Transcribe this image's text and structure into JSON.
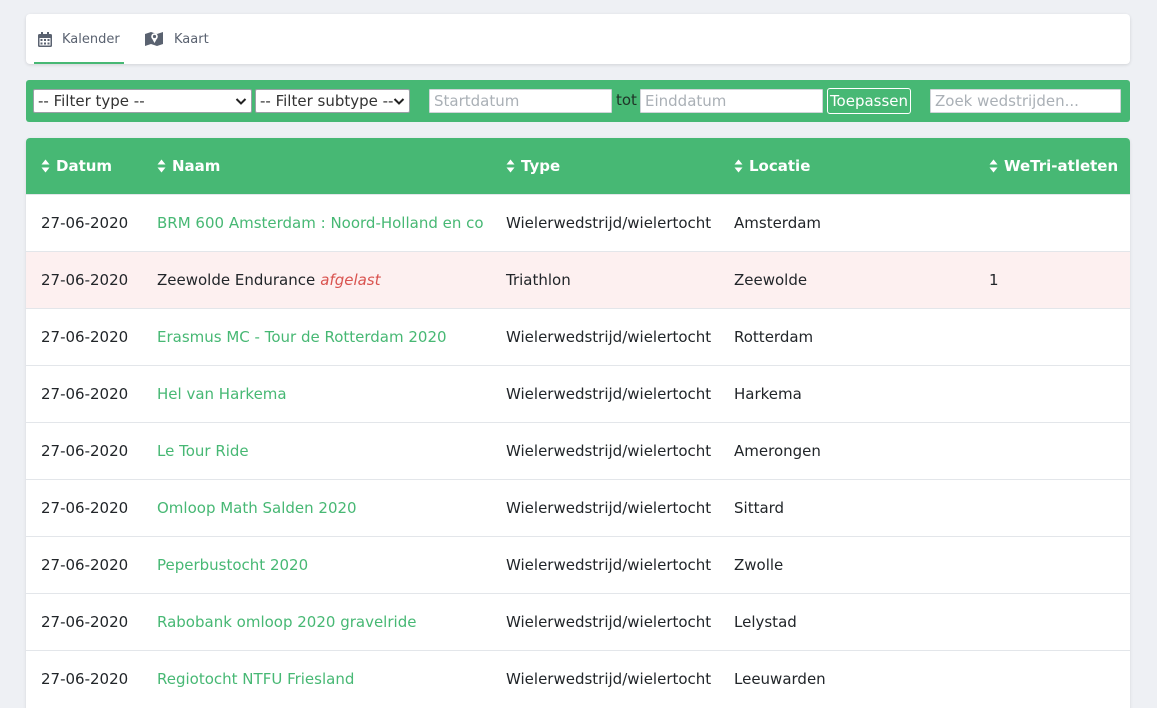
{
  "tabs": [
    {
      "label": "Kalender",
      "icon": "calendar-icon",
      "active": true
    },
    {
      "label": "Kaart",
      "icon": "map-icon",
      "active": false
    }
  ],
  "filters": {
    "type_selected": "-- Filter type --",
    "subtype_selected": "-- Filter subtype --",
    "start_placeholder": "Startdatum",
    "between_label": "tot",
    "end_placeholder": "Einddatum",
    "apply_label": "Toepassen",
    "search_placeholder": "Zoek wedstrijden..."
  },
  "colors": {
    "accent": "#47b874",
    "cancelled_row": "#fdf0f0",
    "cancelled_text": "#d9534f"
  },
  "table": {
    "columns": [
      "Datum",
      "Naam",
      "Type",
      "Locatie",
      "WeTri-atleten"
    ],
    "rows": [
      {
        "date": "27-06-2020",
        "name": "BRM 600 Amsterdam : Noord-Holland en co",
        "link": true,
        "status": "",
        "type": "Wielerwedstrijd/wielertocht",
        "location": "Amsterdam",
        "athletes": ""
      },
      {
        "date": "27-06-2020",
        "name": "Zeewolde Endurance",
        "link": false,
        "status": "afgelast",
        "type": "Triathlon",
        "location": "Zeewolde",
        "athletes": "1"
      },
      {
        "date": "27-06-2020",
        "name": "Erasmus MC - Tour de Rotterdam 2020",
        "link": true,
        "status": "",
        "type": "Wielerwedstrijd/wielertocht",
        "location": "Rotterdam",
        "athletes": ""
      },
      {
        "date": "27-06-2020",
        "name": "Hel van Harkema",
        "link": true,
        "status": "",
        "type": "Wielerwedstrijd/wielertocht",
        "location": "Harkema",
        "athletes": ""
      },
      {
        "date": "27-06-2020",
        "name": "Le Tour Ride",
        "link": true,
        "status": "",
        "type": "Wielerwedstrijd/wielertocht",
        "location": "Amerongen",
        "athletes": ""
      },
      {
        "date": "27-06-2020",
        "name": "Omloop Math Salden 2020",
        "link": true,
        "status": "",
        "type": "Wielerwedstrijd/wielertocht",
        "location": "Sittard",
        "athletes": ""
      },
      {
        "date": "27-06-2020",
        "name": "Peperbustocht 2020",
        "link": true,
        "status": "",
        "type": "Wielerwedstrijd/wielertocht",
        "location": "Zwolle",
        "athletes": ""
      },
      {
        "date": "27-06-2020",
        "name": "Rabobank omloop 2020 gravelride",
        "link": true,
        "status": "",
        "type": "Wielerwedstrijd/wielertocht",
        "location": "Lelystad",
        "athletes": ""
      },
      {
        "date": "27-06-2020",
        "name": "Regiotocht NTFU Friesland",
        "link": true,
        "status": "",
        "type": "Wielerwedstrijd/wielertocht",
        "location": "Leeuwarden",
        "athletes": ""
      }
    ]
  }
}
